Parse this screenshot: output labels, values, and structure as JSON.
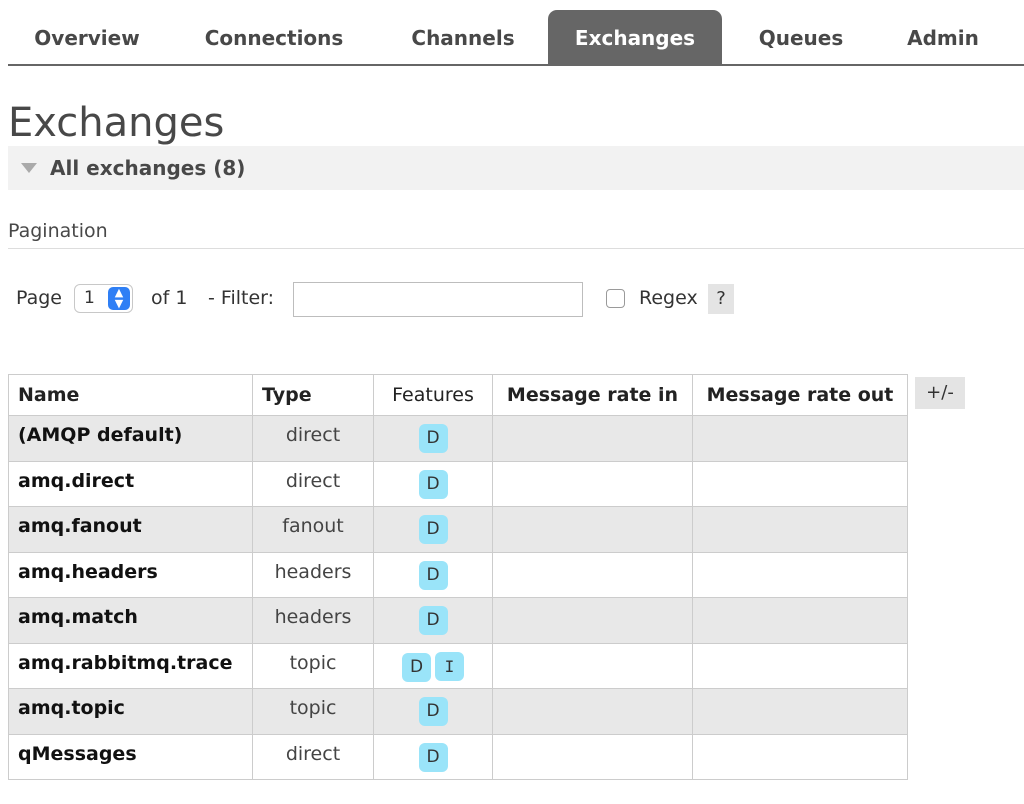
{
  "nav": {
    "tabs": [
      {
        "label": "Overview",
        "active": false
      },
      {
        "label": "Connections",
        "active": false
      },
      {
        "label": "Channels",
        "active": false
      },
      {
        "label": "Exchanges",
        "active": true
      },
      {
        "label": "Queues",
        "active": false
      },
      {
        "label": "Admin",
        "active": false
      }
    ]
  },
  "page": {
    "title": "Exchanges",
    "section_label": "All exchanges (8)"
  },
  "pagination": {
    "label": "Pagination",
    "page_word": "Page",
    "current_page": "1",
    "of_text": "of 1",
    "filter_label": "- Filter:",
    "filter_value": "",
    "regex_label": "Regex",
    "regex_checked": false,
    "help_label": "?"
  },
  "table": {
    "columns": [
      "Name",
      "Type",
      "Features",
      "Message rate in",
      "Message rate out"
    ],
    "toggle_label": "+/-",
    "rows": [
      {
        "name": "(AMQP default)",
        "type": "direct",
        "features": [
          "D"
        ],
        "rate_in": "",
        "rate_out": ""
      },
      {
        "name": "amq.direct",
        "type": "direct",
        "features": [
          "D"
        ],
        "rate_in": "",
        "rate_out": ""
      },
      {
        "name": "amq.fanout",
        "type": "fanout",
        "features": [
          "D"
        ],
        "rate_in": "",
        "rate_out": ""
      },
      {
        "name": "amq.headers",
        "type": "headers",
        "features": [
          "D"
        ],
        "rate_in": "",
        "rate_out": ""
      },
      {
        "name": "amq.match",
        "type": "headers",
        "features": [
          "D"
        ],
        "rate_in": "",
        "rate_out": ""
      },
      {
        "name": "amq.rabbitmq.trace",
        "type": "topic",
        "features": [
          "D",
          "I"
        ],
        "rate_in": "",
        "rate_out": ""
      },
      {
        "name": "amq.topic",
        "type": "topic",
        "features": [
          "D"
        ],
        "rate_in": "",
        "rate_out": ""
      },
      {
        "name": "qMessages",
        "type": "direct",
        "features": [
          "D"
        ],
        "rate_in": "",
        "rate_out": ""
      }
    ]
  },
  "colors": {
    "active_tab_bg": "#666666",
    "feature_badge_bg": "#9ae4f9",
    "select_accent": "#2f7ff5",
    "odd_row_bg": "#e8e8e8"
  }
}
